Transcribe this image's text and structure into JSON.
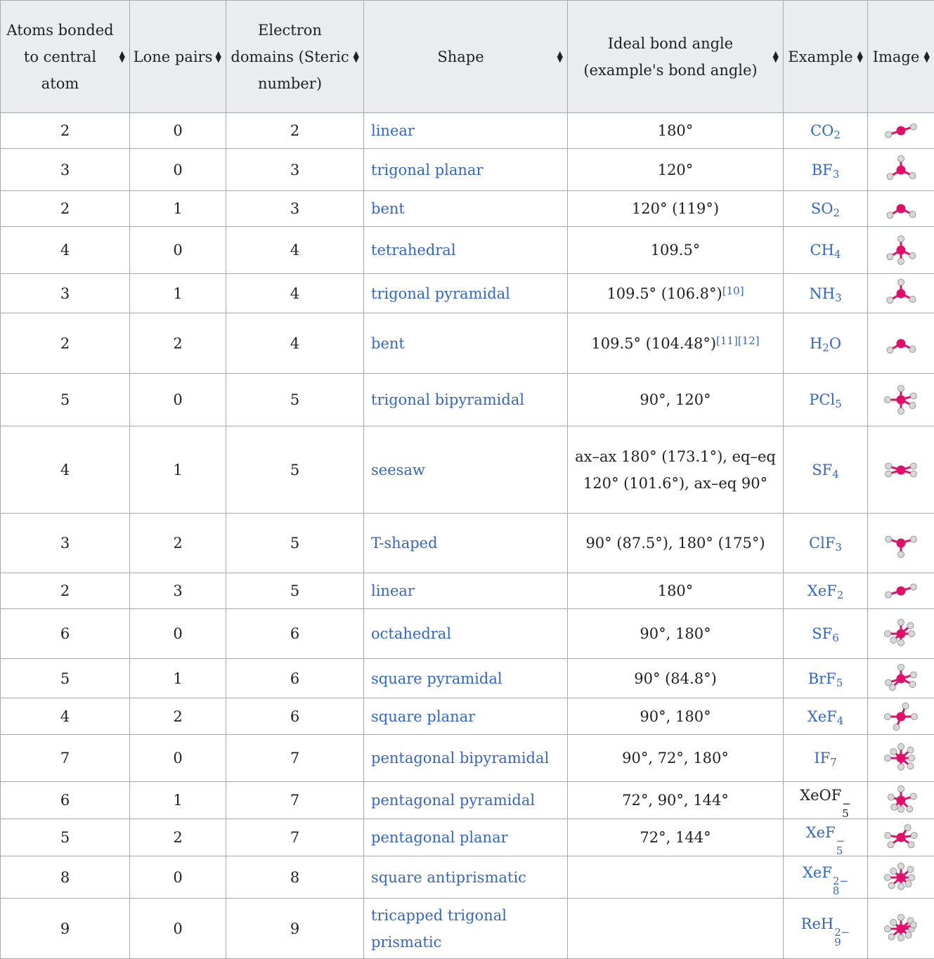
{
  "headers": [
    {
      "label": "Atoms bonded to central atom"
    },
    {
      "label": "Lone pairs"
    },
    {
      "label": "Electron domains (Steric number)"
    },
    {
      "label": "Shape"
    },
    {
      "label": "Ideal bond angle (example's bond angle)"
    },
    {
      "label": "Example"
    },
    {
      "label": "Image"
    }
  ],
  "rows": [
    {
      "atoms": "2",
      "lone": "0",
      "domains": "2",
      "shape": "linear",
      "angle": "180°",
      "ref": "",
      "ex_base": "CO",
      "ex_sub": "2",
      "ex_sup": "",
      "ex_link": true,
      "icon": "linear-molecule-icon"
    },
    {
      "atoms": "3",
      "lone": "0",
      "domains": "3",
      "shape": "trigonal planar",
      "angle": "120°",
      "ref": "",
      "ex_base": "BF",
      "ex_sub": "3",
      "ex_sup": "",
      "ex_link": true,
      "icon": "trigonal-planar-molecule-icon"
    },
    {
      "atoms": "2",
      "lone": "1",
      "domains": "3",
      "shape": "bent",
      "angle": "120° (119°)",
      "ref": "",
      "ex_base": "SO",
      "ex_sub": "2",
      "ex_sup": "",
      "ex_link": true,
      "icon": "bent-molecule-icon"
    },
    {
      "atoms": "4",
      "lone": "0",
      "domains": "4",
      "shape": "tetrahedral",
      "angle": "109.5°",
      "ref": "",
      "ex_base": "CH",
      "ex_sub": "4",
      "ex_sup": "",
      "ex_link": true,
      "icon": "tetrahedral-molecule-icon"
    },
    {
      "atoms": "3",
      "lone": "1",
      "domains": "4",
      "shape": "trigonal pyramidal",
      "angle": "109.5° (106.8°)",
      "ref": "[10]",
      "ex_base": "NH",
      "ex_sub": "3",
      "ex_sup": "",
      "ex_link": true,
      "icon": "trigonal-pyramidal-molecule-icon"
    },
    {
      "atoms": "2",
      "lone": "2",
      "domains": "4",
      "shape": "bent",
      "angle": "109.5° (104.48°)",
      "ref": "[11][12]",
      "ex_base": "H",
      "ex_sub": "2",
      "ex_tail": "O",
      "ex_sup": "",
      "ex_link": true,
      "icon": "bent-molecule-icon"
    },
    {
      "atoms": "5",
      "lone": "0",
      "domains": "5",
      "shape": "trigonal bipyramidal",
      "angle": "90°, 120°",
      "ref": "",
      "ex_base": "PCl",
      "ex_sub": "5",
      "ex_sup": "",
      "ex_link": true,
      "icon": "trigonal-bipyramidal-molecule-icon"
    },
    {
      "atoms": "4",
      "lone": "1",
      "domains": "5",
      "shape": "seesaw",
      "angle": "ax–ax 180° (173.1°), eq–eq 120° (101.6°), ax–eq 90°",
      "ref": "",
      "ex_base": "SF",
      "ex_sub": "4",
      "ex_sup": "",
      "ex_link": true,
      "icon": "seesaw-molecule-icon"
    },
    {
      "atoms": "3",
      "lone": "2",
      "domains": "5",
      "shape": "T-shaped",
      "angle": "90° (87.5°), 180° (175°)",
      "ref": "",
      "ex_base": "ClF",
      "ex_sub": "3",
      "ex_sup": "",
      "ex_link": true,
      "icon": "t-shaped-molecule-icon"
    },
    {
      "atoms": "2",
      "lone": "3",
      "domains": "5",
      "shape": "linear",
      "angle": "180°",
      "ref": "",
      "ex_base": "XeF",
      "ex_sub": "2",
      "ex_sup": "",
      "ex_link": true,
      "icon": "linear-molecule-icon"
    },
    {
      "atoms": "6",
      "lone": "0",
      "domains": "6",
      "shape": "octahedral",
      "angle": "90°, 180°",
      "ref": "",
      "ex_base": "SF",
      "ex_sub": "6",
      "ex_sup": "",
      "ex_link": true,
      "icon": "octahedral-molecule-icon"
    },
    {
      "atoms": "5",
      "lone": "1",
      "domains": "6",
      "shape": "square pyramidal",
      "angle": "90° (84.8°)",
      "ref": "",
      "ex_base": "BrF",
      "ex_sub": "5",
      "ex_sup": "",
      "ex_link": true,
      "icon": "square-pyramidal-molecule-icon"
    },
    {
      "atoms": "4",
      "lone": "2",
      "domains": "6",
      "shape": "square planar",
      "angle": "90°, 180°",
      "ref": "",
      "ex_base": "XeF",
      "ex_sub": "4",
      "ex_sup": "",
      "ex_link": true,
      "icon": "square-planar-molecule-icon"
    },
    {
      "atoms": "7",
      "lone": "0",
      "domains": "7",
      "shape": "pentagonal bipyramidal",
      "angle": "90°, 72°, 180°",
      "ref": "",
      "ex_base": "IF",
      "ex_sub": "7",
      "ex_sup": "",
      "ex_link": true,
      "icon": "pentagonal-bipyramidal-molecule-icon"
    },
    {
      "atoms": "6",
      "lone": "1",
      "domains": "7",
      "shape": "pentagonal pyramidal",
      "angle": "72°, 90°, 144°",
      "ref": "",
      "ex_base": "XeOF",
      "ex_sub": "5",
      "ex_sup": "−",
      "ex_link": false,
      "icon": "pentagonal-pyramidal-molecule-icon"
    },
    {
      "atoms": "5",
      "lone": "2",
      "domains": "7",
      "shape": "pentagonal planar",
      "angle": "72°, 144°",
      "ref": "",
      "ex_base": "XeF",
      "ex_sub": "5",
      "ex_sup": "−",
      "ex_link": true,
      "icon": "pentagonal-planar-molecule-icon"
    },
    {
      "atoms": "8",
      "lone": "0",
      "domains": "8",
      "shape": "square antiprismatic",
      "angle": "",
      "ref": "",
      "ex_base": "XeF",
      "ex_sub": "8",
      "ex_sup": "2−",
      "ex_link": true,
      "icon": "square-antiprismatic-molecule-icon"
    },
    {
      "atoms": "9",
      "lone": "0",
      "domains": "9",
      "shape": "tricapped trigonal prismatic",
      "angle": "",
      "ref": "",
      "ex_base": "ReH",
      "ex_sub": "9",
      "ex_sup": "2−",
      "ex_link": true,
      "icon": "tricapped-trigonal-prismatic-molecule-icon"
    }
  ],
  "colors": {
    "link": "#3366cc",
    "header_bg": "#eaecf0",
    "border": "#a2a9b1",
    "central_atom": "#e0106a",
    "outer_atom": "#d8d8d8"
  }
}
